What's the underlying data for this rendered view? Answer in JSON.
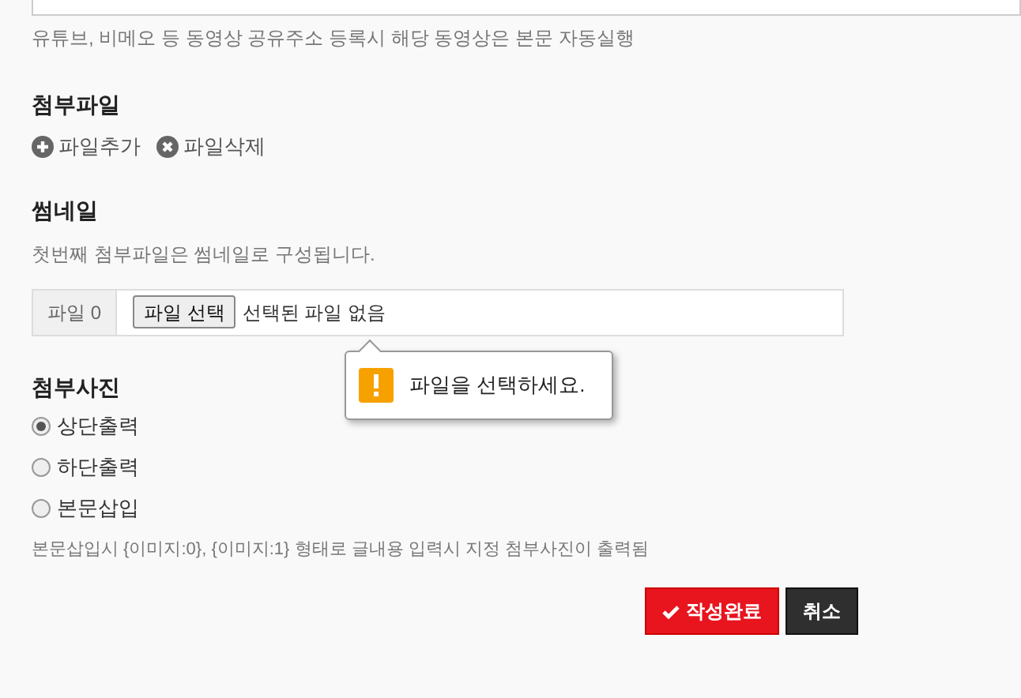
{
  "video_hint": "유튜브, 비메오 등 동영상 공유주소 등록시 해당 동영상은 본문 자동실행",
  "attachments": {
    "title": "첨부파일",
    "actions": [
      {
        "kind": "add",
        "label": "파일추가"
      },
      {
        "kind": "delete",
        "label": "파일삭제"
      }
    ]
  },
  "thumbnail": {
    "title": "썸네일",
    "hint": "첫번째 첨부파일은 썸네일로 구성됩니다.",
    "file_label": "파일 0",
    "choose_button": "파일 선택",
    "file_status": "선택된 파일 없음",
    "tooltip": "파일을 선택하세요."
  },
  "photos": {
    "title": "첨부사진",
    "options": [
      {
        "label": "상단출력",
        "selected": true
      },
      {
        "label": "하단출력",
        "selected": false
      },
      {
        "label": "본문삽입",
        "selected": false
      }
    ],
    "note": "본문삽입시 {이미지:0}, {이미지:1} 형태로 글내용 입력시 지정 첨부사진이 출력됨"
  },
  "buttons": [
    {
      "kind": "submit",
      "label": "작성완료"
    },
    {
      "kind": "cancel",
      "label": "취소"
    }
  ]
}
